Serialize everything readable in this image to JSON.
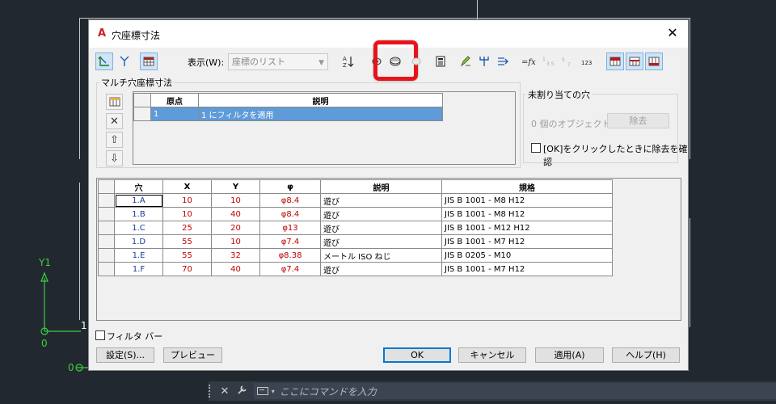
{
  "background": {
    "ucs_y_label": "Y1",
    "ucs_zero_label": "0",
    "ucs_one_label": "1",
    "ucs_bottom_zero": "0"
  },
  "command_bar": {
    "placeholder": "ここにコマンドを入力",
    "close_glyph": "✕",
    "settings_glyph": "🔧"
  },
  "dialog": {
    "title": "穴座標寸法",
    "close_glyph": "✕",
    "toolbar": {
      "display_label": "表示(W):",
      "display_value": "座標のリスト",
      "highlight_color": "#e8131a"
    },
    "multi_group": {
      "title": "マルチ穴座標寸法",
      "columns": [
        "原点",
        "説明"
      ],
      "rows": [
        {
          "origin": "1",
          "description": "1 にフィルタを適用"
        }
      ]
    },
    "unassigned_group": {
      "title": "未割り当ての穴",
      "objects_text": "0 個のオブジェクト",
      "remove_button": "除去",
      "confirm_checkbox": "[OK]をクリックしたときに除去を確認"
    },
    "holes_table": {
      "columns": [
        "穴",
        "X",
        "Y",
        "φ",
        "説明",
        "規格"
      ],
      "rows": [
        {
          "hole": "1.A",
          "x": "10",
          "y": "10",
          "phi": "φ8.4",
          "desc": "遊び",
          "spec": "JIS B 1001 - M8  H12"
        },
        {
          "hole": "1.B",
          "x": "10",
          "y": "40",
          "phi": "φ8.4",
          "desc": "遊び",
          "spec": "JIS B 1001 - M8  H12"
        },
        {
          "hole": "1.C",
          "x": "25",
          "y": "20",
          "phi": "φ13",
          "desc": "遊び",
          "spec": "JIS B 1001 - M12  H12"
        },
        {
          "hole": "1.D",
          "x": "55",
          "y": "10",
          "phi": "φ7.4",
          "desc": "遊び",
          "spec": "JIS B 1001 - M7  H12"
        },
        {
          "hole": "1.E",
          "x": "55",
          "y": "32",
          "phi": "φ8.38",
          "desc": "メートル ISO ねじ",
          "spec": "JIS B 0205 - M10"
        },
        {
          "hole": "1.F",
          "x": "70",
          "y": "40",
          "phi": "φ7.4",
          "desc": "遊び",
          "spec": "JIS B 1001 - M7  H12"
        }
      ]
    },
    "filter_bar_checkbox": "フィルタ バー",
    "buttons": {
      "settings": "設定(S)...",
      "preview": "プレビュー",
      "ok": "OK",
      "cancel": "キャンセル",
      "apply": "適用(A)",
      "help": "ヘルプ(H)"
    }
  }
}
